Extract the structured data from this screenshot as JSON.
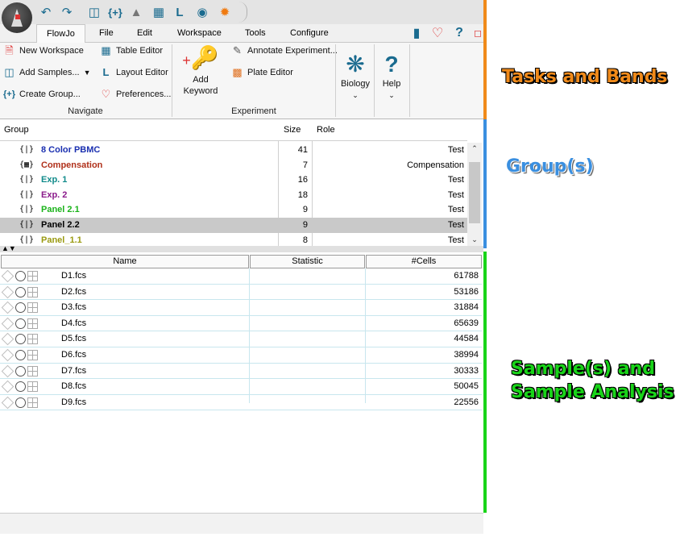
{
  "menu": {
    "tabs": [
      "FlowJo",
      "File",
      "Edit",
      "Workspace",
      "Tools",
      "Configure"
    ]
  },
  "ribbon": {
    "navigate": {
      "new_workspace": "New Workspace",
      "add_samples": "Add Samples...",
      "create_group": "Create Group...",
      "table_editor": "Table Editor",
      "layout_editor": "Layout Editor",
      "preferences": "Preferences...",
      "label": "Navigate"
    },
    "experiment": {
      "add_keyword_line1": "Add",
      "add_keyword_line2": "Keyword",
      "annotate": "Annotate Experiment...",
      "plate_editor": "Plate Editor",
      "label": "Experiment"
    },
    "biology": "Biology",
    "help": "Help"
  },
  "groups": {
    "headers": {
      "group": "Group",
      "size": "Size",
      "role": "Role"
    },
    "rows": [
      {
        "name": "8 Color PBMC",
        "size": "41",
        "role": "Test",
        "color": "#1a2fb0",
        "icon": "{|}"
      },
      {
        "name": "Compensation",
        "size": "7",
        "role": "Compensation",
        "color": "#b0301a",
        "icon": "{▦}"
      },
      {
        "name": "Exp. 1",
        "size": "16",
        "role": "Test",
        "color": "#118b8b",
        "icon": "{|}"
      },
      {
        "name": "Exp. 2",
        "size": "18",
        "role": "Test",
        "color": "#8a1a8a",
        "icon": "{|}"
      },
      {
        "name": "Panel 2.1",
        "size": "9",
        "role": "Test",
        "color": "#1ab31a",
        "icon": "{|}"
      },
      {
        "name": "Panel 2.2",
        "size": "9",
        "role": "Test",
        "color": "#000000",
        "icon": "{|}",
        "selected": true
      },
      {
        "name": "Panel_1.1",
        "size": "8",
        "role": "Test",
        "color": "#9a9a10",
        "icon": "{|}"
      }
    ]
  },
  "samples": {
    "headers": {
      "name": "Name",
      "statistic": "Statistic",
      "cells": "#Cells"
    },
    "rows": [
      {
        "name": "D1.fcs",
        "cells": "61788"
      },
      {
        "name": "D2.fcs",
        "cells": "53186"
      },
      {
        "name": "D3.fcs",
        "cells": "31884"
      },
      {
        "name": "D4.fcs",
        "cells": "65639"
      },
      {
        "name": "D5.fcs",
        "cells": "44584"
      },
      {
        "name": "D6.fcs",
        "cells": "38994"
      },
      {
        "name": "D7.fcs",
        "cells": "30333"
      },
      {
        "name": "D8.fcs",
        "cells": "50045"
      },
      {
        "name": "D9.fcs",
        "cells": "22556"
      }
    ]
  },
  "annotations": {
    "tasks": "Tasks and Bands",
    "groups": "Group(s)",
    "samples_line1": "Sample(s) and",
    "samples_line2": "Sample Analysis"
  },
  "colors": {
    "tasks_bar": "#f08a1a",
    "groups_bar": "#3a8fe0",
    "samples_bar": "#19d419"
  }
}
